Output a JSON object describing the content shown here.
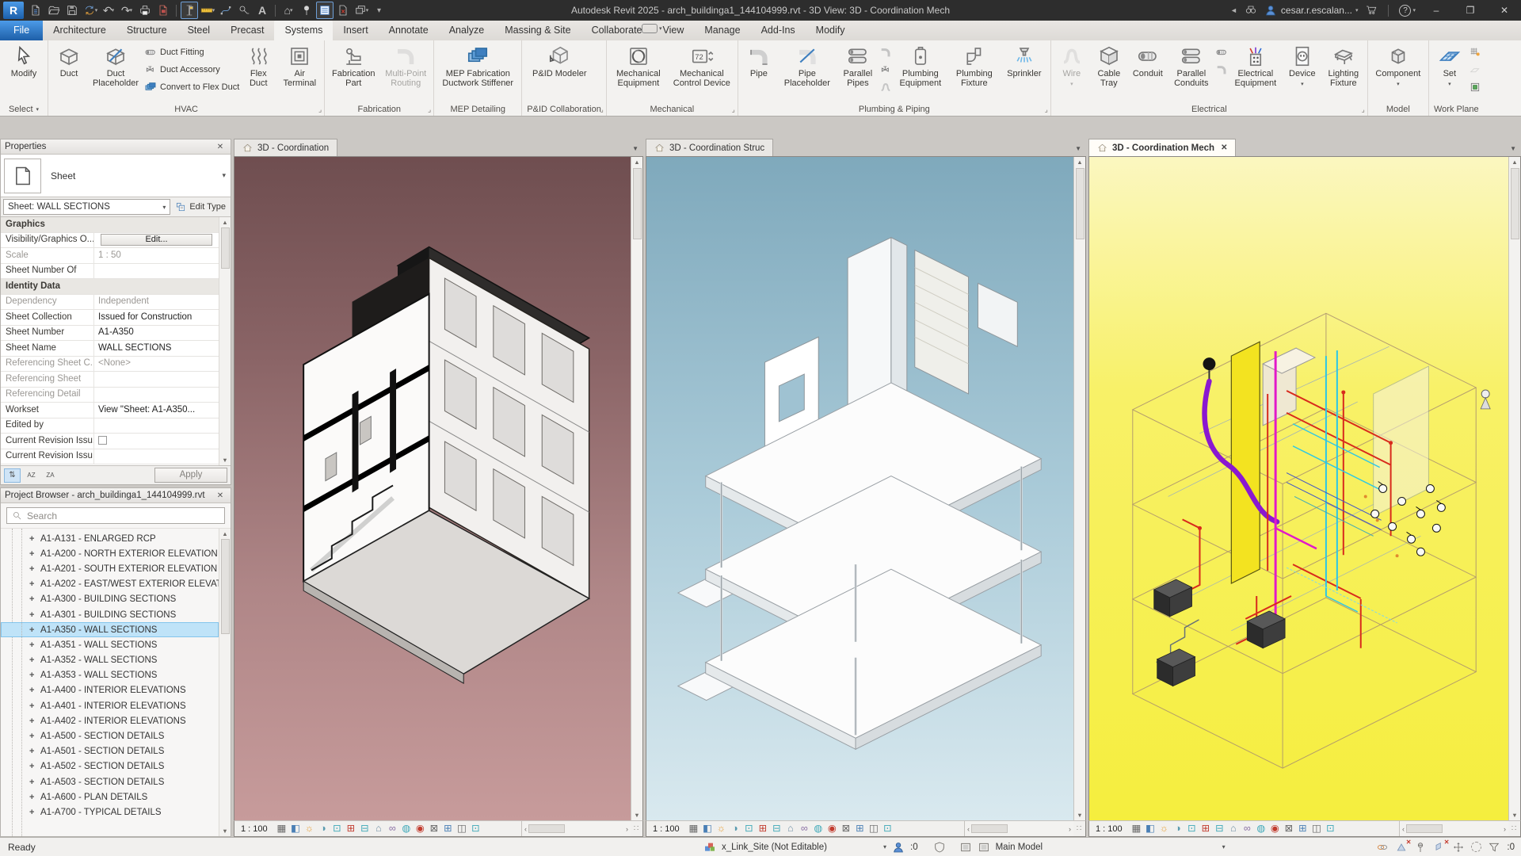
{
  "ui": {
    "dropdown": "▾",
    "chevron": "▼",
    "close": "✕",
    "up": "▲",
    "down": "▼",
    "left": "‹",
    "right": "›",
    "back": "◄",
    "minimize": "–",
    "restore": "❐",
    "undo": "↶",
    "redo": "↷",
    "caret": "▴",
    "plus": "+",
    "grip": "∷",
    "launcher": "⌟",
    "text_glyph": "A",
    "help": "?"
  },
  "title_bar": {
    "logo": "R",
    "title": "Autodesk Revit 2025 - arch_buildinga1_144104999.rvt - 3D View: 3D - Coordination Mech",
    "user": "cesar.r.escalan..."
  },
  "ribbon": {
    "tabs": [
      {
        "label": "File",
        "file": true
      },
      {
        "label": "Architecture"
      },
      {
        "label": "Structure"
      },
      {
        "label": "Steel"
      },
      {
        "label": "Precast"
      },
      {
        "label": "Systems",
        "active": true
      },
      {
        "label": "Insert"
      },
      {
        "label": "Annotate"
      },
      {
        "label": "Analyze"
      },
      {
        "label": "Massing & Site"
      },
      {
        "label": "Collaborate"
      },
      {
        "label": "View"
      },
      {
        "label": "Manage"
      },
      {
        "label": "Add-Ins"
      },
      {
        "label": "Modify"
      }
    ],
    "select": {
      "modify": "Modify",
      "footer": "Select"
    },
    "hvac": {
      "duct": "Duct",
      "duct_placeholder": "Duct Placeholder",
      "duct_fitting": "Duct  Fitting",
      "duct_accessory": "Duct  Accessory",
      "convert": "Convert to  Flex Duct",
      "flex_duct": "Flex Duct",
      "air_terminal": "Air Terminal",
      "footer": "HVAC"
    },
    "fabrication": {
      "part": "Fabrication Part",
      "multi_point": "Multi-Point Routing",
      "footer": "Fabrication"
    },
    "mep_detailing": {
      "stiffener": "MEP Fabrication Ductwork Stiffener",
      "footer": "MEP Detailing"
    },
    "pid": {
      "modeler": "P&ID Modeler",
      "footer": "P&ID Collaboration"
    },
    "mechanical": {
      "equipment": "Mechanical Equipment",
      "control": "Mechanical Control Device",
      "footer": "Mechanical"
    },
    "plumbing": {
      "pipe": "Pipe",
      "placeholder": "Pipe Placeholder",
      "parallel": "Parallel Pipes",
      "equipment": "Plumbing Equipment",
      "fixture": "Plumbing Fixture",
      "sprinkler": "Sprinkler",
      "footer": "Plumbing & Piping"
    },
    "electrical": {
      "wire": "Wire",
      "cable_tray": "Cable Tray",
      "conduit": "Conduit",
      "parallel": "Parallel Conduits",
      "equipment": "Electrical Equipment",
      "device": "Device",
      "lighting": "Lighting Fixture",
      "footer": "Electrical"
    },
    "model": {
      "component": "Component",
      "footer": "Model"
    },
    "work_plane": {
      "set": "Set",
      "footer": "Work Plane"
    }
  },
  "properties": {
    "header": "Properties",
    "category": "Sheet",
    "selector": "Sheet: WALL SECTIONS",
    "edit_type": "Edit Type",
    "sort": [
      "⇅",
      "AZ",
      "ZA"
    ],
    "apply": "Apply",
    "rows": [
      {
        "label": "Graphics",
        "group": true
      },
      {
        "label": "Visibility/Graphics O...",
        "value": "Edit...",
        "button": true
      },
      {
        "label": "Scale",
        "value": "1 : 50",
        "muted": true
      },
      {
        "label": "Sheet Number Of",
        "value": ""
      },
      {
        "label": "Identity Data",
        "group": true
      },
      {
        "label": "Dependency",
        "value": "Independent",
        "muted": true
      },
      {
        "label": "Sheet Collection",
        "value": "Issued for Construction"
      },
      {
        "label": "Sheet Number",
        "value": "A1-A350"
      },
      {
        "label": "Sheet Name",
        "value": "WALL SECTIONS"
      },
      {
        "label": "Referencing Sheet C...",
        "value": "<None>",
        "muted": true
      },
      {
        "label": "Referencing Sheet",
        "value": "",
        "muted": true
      },
      {
        "label": "Referencing Detail",
        "value": "",
        "muted": true
      },
      {
        "label": "Workset",
        "value": "View \"Sheet: A1-A350..."
      },
      {
        "label": "Edited by",
        "value": ""
      },
      {
        "label": "Current Revision Issu...",
        "checkbox": true
      },
      {
        "label": "Current Revision Issu",
        "value": ""
      }
    ]
  },
  "project_browser": {
    "header": "Project Browser - arch_buildinga1_144104999.rvt",
    "search_placeholder": "Search",
    "items": [
      {
        "label": "A1-A131 - ENLARGED RCP"
      },
      {
        "label": "A1-A200 - NORTH EXTERIOR ELEVATION"
      },
      {
        "label": "A1-A201 - SOUTH EXTERIOR ELEVATION"
      },
      {
        "label": "A1-A202 - EAST/WEST EXTERIOR ELEVAT"
      },
      {
        "label": "A1-A300 - BUILDING SECTIONS"
      },
      {
        "label": "A1-A301 - BUILDING SECTIONS"
      },
      {
        "label": "A1-A350 - WALL SECTIONS",
        "selected": true
      },
      {
        "label": "A1-A351 - WALL SECTIONS"
      },
      {
        "label": "A1-A352 - WALL SECTIONS"
      },
      {
        "label": "A1-A353 - WALL SECTIONS"
      },
      {
        "label": "A1-A400 - INTERIOR ELEVATIONS"
      },
      {
        "label": "A1-A401 - INTERIOR ELEVATIONS"
      },
      {
        "label": "A1-A402 - INTERIOR ELEVATIONS"
      },
      {
        "label": "A1-A500 - SECTION DETAILS"
      },
      {
        "label": "A1-A501 - SECTION DETAILS"
      },
      {
        "label": "A1-A502 - SECTION DETAILS"
      },
      {
        "label": "A1-A503 - SECTION DETAILS"
      },
      {
        "label": "A1-A600 - PLAN DETAILS"
      },
      {
        "label": "A1-A700 - TYPICAL DETAILS"
      }
    ]
  },
  "viewports": [
    {
      "tab": "3D - Coordination",
      "scale": "1 : 100",
      "active": false,
      "bg_top": "#6F4E50",
      "bg_bottom": "#C79B9B"
    },
    {
      "tab": "3D - Coordination Struc",
      "scale": "1 : 100",
      "active": false,
      "bg_top": "#7FA9BC",
      "bg_bottom": "#D9E9EF"
    },
    {
      "tab": "3D - Coordination Mech",
      "scale": "1 : 100",
      "active": true,
      "bg_top": "#FBF7C0",
      "bg_bottom": "#F5EE3E"
    }
  ],
  "view_control": {
    "icons": [
      {
        "name": "detail-level-icon",
        "glyph": "▦",
        "color": "#666666"
      },
      {
        "name": "visual-style-icon",
        "glyph": "◧",
        "color": "#4A7FB5"
      },
      {
        "name": "sun-path-icon",
        "glyph": "☼",
        "color": "#E8A33D"
      },
      {
        "name": "shadows-icon",
        "glyph": "◑",
        "color": "#5A9BB0"
      },
      {
        "name": "crop-view-icon",
        "glyph": "⊡",
        "color": "#3FA9B8"
      },
      {
        "name": "show-crop-region-icon",
        "glyph": "⊞",
        "color": "#C23B2E"
      },
      {
        "name": "hide-crop-region-icon",
        "glyph": "⊟",
        "color": "#3FA9B8"
      },
      {
        "name": "temporary-hide-isolate-icon",
        "glyph": "⌂",
        "color": "#6E8FA5"
      },
      {
        "name": "reveal-hidden-elements-icon",
        "glyph": "∞",
        "color": "#8A6FA5"
      },
      {
        "name": "temporary-view-properties-icon",
        "glyph": "◍",
        "color": "#3FA9B8"
      },
      {
        "name": "worksharing-display-icon",
        "glyph": "◉",
        "color": "#C23B2E"
      },
      {
        "name": "constraints-icon",
        "glyph": "⊠",
        "color": "#666666"
      },
      {
        "name": "reveal-constraints-icon",
        "glyph": "⊞",
        "color": "#4A7FB5"
      },
      {
        "name": "analytical-model-icon",
        "glyph": "◫",
        "color": "#666666"
      },
      {
        "name": "highlight-displacement-icon",
        "glyph": "⊡",
        "color": "#3FA9B8"
      }
    ]
  },
  "status_bar": {
    "ready": "Ready",
    "workset": "x_Link_Site (Not Editable)",
    "editable_count": ":0",
    "active_model": "Main Model",
    "selection_filter_count": ":0"
  }
}
